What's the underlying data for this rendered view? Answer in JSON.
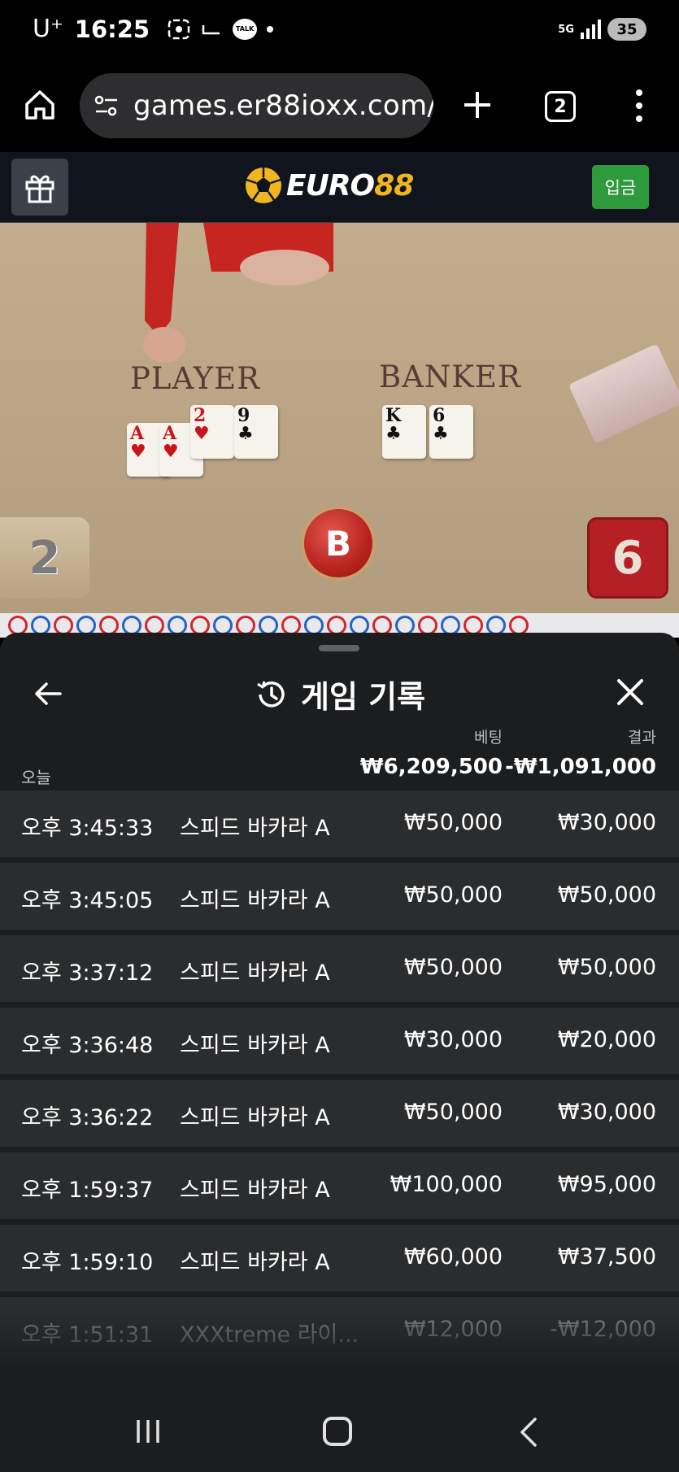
{
  "status_bar": {
    "carrier": "U⁺",
    "time": "16:25",
    "talk_label": "TALK",
    "network_label": "5G",
    "battery": "35"
  },
  "browser": {
    "url": "games.er88ioxx.com/",
    "tab_count": "2"
  },
  "site": {
    "logo_text_1": "EURO",
    "logo_text_2": "88",
    "deposit_label": "입금"
  },
  "game": {
    "player_label": "PLAYER",
    "banker_label": "BANKER",
    "player_score": "2",
    "banker_score": "6",
    "result": "B",
    "player_cards": [
      {
        "rank": "A",
        "suit": "♥",
        "color": "red"
      },
      {
        "rank": "A",
        "suit": "♥",
        "color": "red"
      },
      {
        "rank": "2",
        "suit": "♥",
        "color": "red"
      },
      {
        "rank": "9",
        "suit": "♣",
        "color": "black"
      }
    ],
    "banker_cards": [
      {
        "rank": "K",
        "suit": "♣",
        "color": "black"
      },
      {
        "rank": "6",
        "suit": "♣",
        "color": "black"
      }
    ]
  },
  "history": {
    "title": "게임 기록",
    "col_bet": "베팅",
    "col_result": "결과",
    "summary_label": "오늘",
    "summary_bet": "₩6,209,500",
    "summary_result": "-₩1,091,000",
    "rows": [
      {
        "time": "오후 3:45:33",
        "game": "스피드 바카라 A",
        "bet": "₩50,000",
        "result": "₩30,000"
      },
      {
        "time": "오후 3:45:05",
        "game": "스피드 바카라 A",
        "bet": "₩50,000",
        "result": "₩50,000"
      },
      {
        "time": "오후 3:37:12",
        "game": "스피드 바카라 A",
        "bet": "₩50,000",
        "result": "₩50,000"
      },
      {
        "time": "오후 3:36:48",
        "game": "스피드 바카라 A",
        "bet": "₩30,000",
        "result": "₩20,000"
      },
      {
        "time": "오후 3:36:22",
        "game": "스피드 바카라 A",
        "bet": "₩50,000",
        "result": "₩30,000"
      },
      {
        "time": "오후 1:59:37",
        "game": "스피드 바카라 A",
        "bet": "₩100,000",
        "result": "₩95,000"
      },
      {
        "time": "오후 1:59:10",
        "game": "스피드 바카라 A",
        "bet": "₩60,000",
        "result": "₩37,500"
      },
      {
        "time": "오후 1:51:31",
        "game": "XXXtreme 라이...",
        "bet": "₩12,000",
        "result": "-₩12,000"
      }
    ]
  },
  "colors": {
    "accent_green": "#2f9a3c",
    "banker_red": "#b52024",
    "logo_gold": "#f0b51f",
    "sheet_bg": "#1c1d1f",
    "row_bg": "#2b2c2e"
  }
}
